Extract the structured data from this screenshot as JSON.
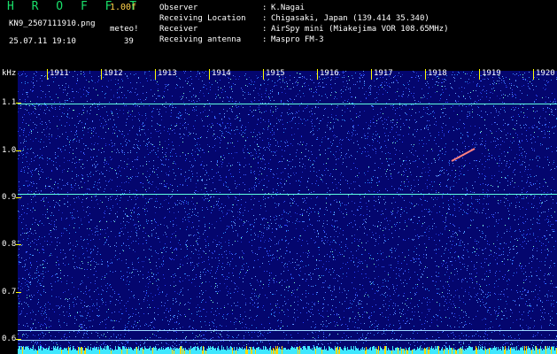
{
  "header": {
    "app_title": "H R O F F T",
    "version": "1.00f",
    "filename": "KN9_2507111910.png",
    "meteo_label": "meteo!",
    "datetime": "25.07.11 19:10",
    "count": "39",
    "fields": [
      {
        "label": "Observer",
        "value": "K.Nagai"
      },
      {
        "label": "Receiving Location",
        "value": "Chigasaki, Japan (139.414 35.340)"
      },
      {
        "label": "Receiver",
        "value": "AirSpy mini (Miakejima VOR 108.65MHz)"
      },
      {
        "label": "Receiving antenna",
        "value": "Maspro FM-3"
      }
    ]
  },
  "spectrogram": {
    "unit_label": "kHz",
    "x_ticks": [
      "1911",
      "1912",
      "1913",
      "1914",
      "1915",
      "1916",
      "1917",
      "1918",
      "1919",
      "1920"
    ],
    "y_ticks": [
      "1.1",
      "1.0",
      "0.9",
      "0.8",
      "0.7",
      "0.6"
    ],
    "y_range": [
      0.57,
      1.17
    ],
    "carrier_lines_khz": [
      1.1,
      0.91,
      0.62,
      0.6
    ],
    "colors": {
      "background": "#04066e",
      "noise": "#3a5cff",
      "line": "#5fffe0",
      "tick": "#ffff00",
      "meteor": "#ff8080"
    }
  }
}
